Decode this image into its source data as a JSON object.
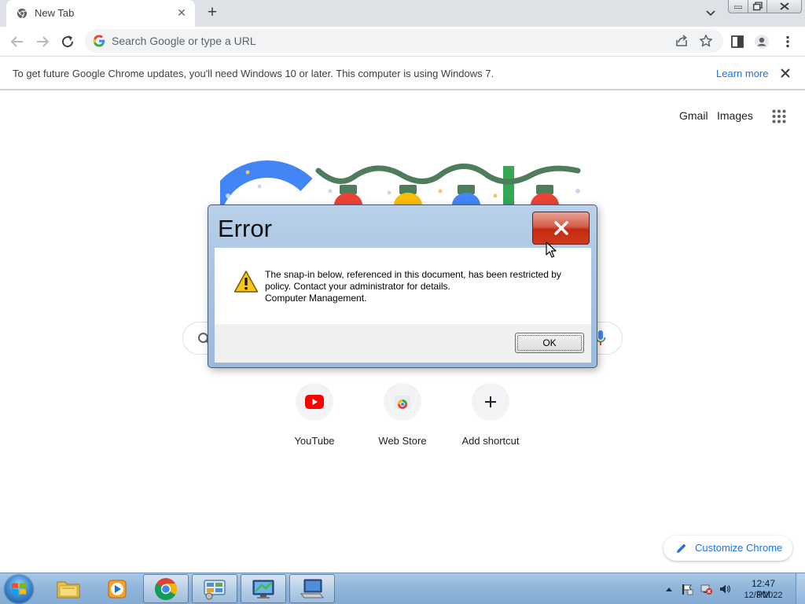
{
  "browser": {
    "tab_title": "New Tab",
    "omnibox_placeholder": "Search Google or type a URL"
  },
  "infobar": {
    "message": "To get future Google Chrome updates, you'll need Windows 10 or later. This computer is using Windows 7.",
    "link": "Learn more"
  },
  "ntp": {
    "gmail": "Gmail",
    "images": "Images",
    "shortcuts": [
      {
        "label": "YouTube",
        "icon": "youtube-icon"
      },
      {
        "label": "Web Store",
        "icon": "web-store-icon"
      },
      {
        "label": "Add shortcut",
        "icon": "plus-icon"
      }
    ],
    "customize": "Customize Chrome"
  },
  "dialog": {
    "title": "Error",
    "message_lines": [
      "The snap-in below, referenced in this document, has been restricted by",
      "policy. Contact your administrator for details.",
      "Computer Management."
    ],
    "ok_label": "OK"
  },
  "taskbar": {
    "items": [
      "windows-explorer-icon",
      "media-player-icon",
      "chrome-icon",
      "control-panel-icon",
      "remote-desktop-icon",
      "computer-management-icon"
    ],
    "time": "12:47 PM",
    "date": "12/3/2022"
  },
  "colors": {
    "accent": "#1a73e8",
    "dialog_close": "#c52a10",
    "taskbar": "#8eb4da"
  }
}
